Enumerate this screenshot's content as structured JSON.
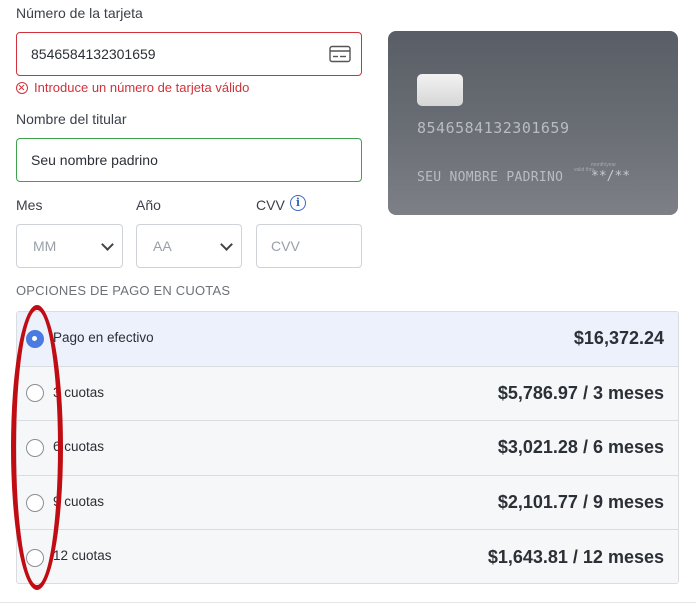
{
  "form": {
    "card_number_label": "Número de la tarjeta",
    "card_number_value": "8546584132301659",
    "card_number_error": "Introduce un número de tarjeta válido",
    "holder_label": "Nombre del titular",
    "holder_value": "Seu nombre padrino",
    "month_label": "Mes",
    "month_value": "MM",
    "year_label": "Año",
    "year_value": "AA",
    "cvv_label": "CVV",
    "cvv_placeholder": "CVV"
  },
  "card_preview": {
    "number": "8546584132301659",
    "holder": "SEU NOMBRE PADRINO",
    "valid_small": "valid thru",
    "expiry_small": "month/year",
    "expiry": "**/**"
  },
  "installments": {
    "title": "OPCIONES DE PAGO EN CUOTAS",
    "options": [
      {
        "label": "Pago en efectivo",
        "price": "$16,372.24",
        "selected": true
      },
      {
        "label": "3 cuotas",
        "price": "$5,786.97 / 3 meses",
        "selected": false
      },
      {
        "label": "6 cuotas",
        "price": "$3,021.28 / 6 meses",
        "selected": false
      },
      {
        "label": "9 cuotas",
        "price": "$2,101.77 / 9 meses",
        "selected": false
      },
      {
        "label": "12 cuotas",
        "price": "$1,643.81 / 12 meses",
        "selected": false
      }
    ]
  },
  "colors": {
    "error": "#d0323b",
    "valid": "#3fa34d",
    "accent": "#4a7be0",
    "annotation": "#c00d14"
  }
}
